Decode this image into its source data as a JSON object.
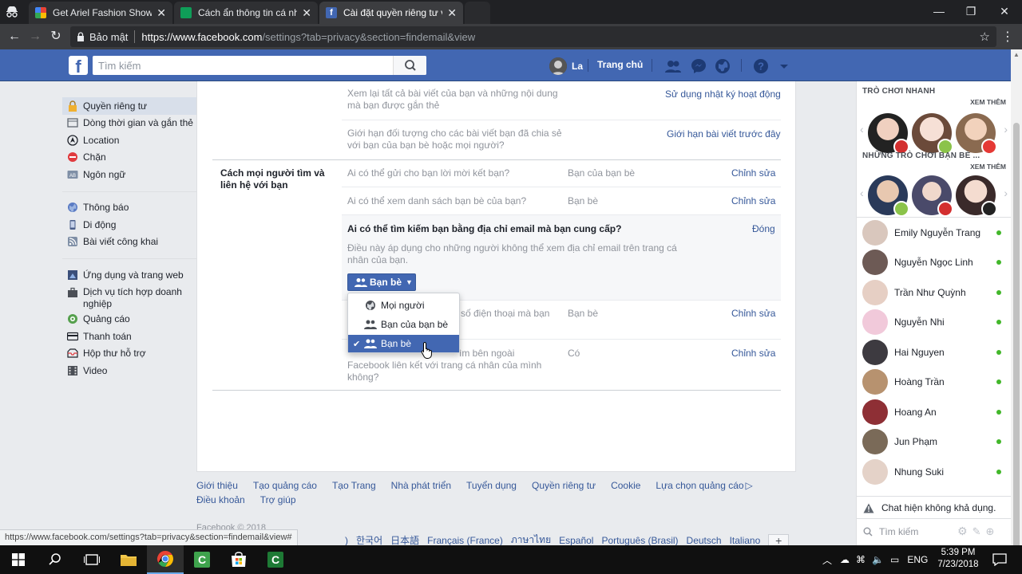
{
  "browser": {
    "tabs": [
      {
        "title": "Get Ariel Fashion Show -",
        "active": false
      },
      {
        "title": "Cách ẩn thông tin cá nhâ",
        "active": false
      },
      {
        "title": "Cài đặt quyền riêng tư và",
        "active": true
      }
    ],
    "security_label": "Bảo mật",
    "url_main": "https://www.facebook.com",
    "url_rest": "/settings?tab=privacy&section=findemail&view",
    "status_url": "https://www.facebook.com/settings?tab=privacy&section=findemail&view#"
  },
  "fb_header": {
    "search_placeholder": "Tìm kiếm",
    "user_name": "La",
    "home_label": "Trang chủ",
    "brand_color": "#4267b2"
  },
  "left_nav": {
    "group1": [
      {
        "label": "Quyền riêng tư",
        "icon": "padlock-icon",
        "active": true
      },
      {
        "label": "Dòng thời gian và gắn thẻ",
        "icon": "timeline-icon"
      },
      {
        "label": "Location",
        "icon": "location-icon"
      },
      {
        "label": "Chặn",
        "icon": "block-icon"
      },
      {
        "label": "Ngôn ngữ",
        "icon": "language-icon"
      }
    ],
    "group2": [
      {
        "label": "Thông báo",
        "icon": "globe-notification-icon"
      },
      {
        "label": "Di động",
        "icon": "mobile-icon"
      },
      {
        "label": "Bài viết công khai",
        "icon": "rss-icon"
      }
    ],
    "group3": [
      {
        "label": "Ứng dụng và trang web",
        "icon": "apps-icon"
      },
      {
        "label": "Dịch vụ tích hợp doanh nghiệp",
        "icon": "business-icon"
      },
      {
        "label": "Quảng cáo",
        "icon": "ads-icon"
      },
      {
        "label": "Thanh toán",
        "icon": "payment-card-icon"
      },
      {
        "label": "Hộp thư hỗ trợ",
        "icon": "support-inbox-icon"
      },
      {
        "label": "Video",
        "icon": "video-icon"
      }
    ]
  },
  "privacy": {
    "top_rows": [
      {
        "question": "Xem lại tất cả bài viết của bạn và những nội dung mà bạn được gắn thẻ",
        "action": "Sử dụng nhật ký hoạt động"
      },
      {
        "question": "Giới hạn đối tượng cho các bài viết bạn đã chia sẻ với bạn của bạn bè hoặc mọi người?",
        "action": "Giới hạn bài viết trước đây"
      }
    ],
    "section_title": "Cách mọi người tìm và liên hệ với bạn",
    "rows": [
      {
        "question": "Ai có thể gửi cho bạn lời mời kết bạn?",
        "value": "Bạn của bạn bè",
        "action": "Chỉnh sửa"
      },
      {
        "question": "Ai có thể xem danh sách bạn bè của bạn?",
        "value": "Bạn bè",
        "action": "Chỉnh sửa"
      }
    ],
    "expanded": {
      "question": "Ai có thể tìm kiếm bạn bằng địa chỉ email mà bạn cung cấp?",
      "close": "Đóng",
      "description": "Điều này áp dụng cho những người không thể xem địa chỉ email trên trang cá nhân của bạn.",
      "selected": "Bạn bè",
      "options": [
        "Mọi người",
        "Bạn của bạn bè",
        "Bạn bè"
      ]
    },
    "phone_row": {
      "question_visible": "số điện thoại mà bạn",
      "value": "Bạn bè",
      "action": "Chỉnh sửa"
    },
    "search_row": {
      "question_part1": "ìm bên ngoài",
      "question_part2": "Facebook liên kết với trang cá nhân của mình",
      "question_part3": "không?",
      "value": "Có",
      "action": "Chỉnh sửa"
    }
  },
  "footer": {
    "links": [
      "Giới thiệu",
      "Tạo quảng cáo",
      "Tạo Trang",
      "Nhà phát triển",
      "Tuyển dụng",
      "Quyền riêng tư",
      "Cookie",
      "Lựa chọn quảng cáo",
      "Điều khoản",
      "Trợ giúp"
    ],
    "copyright": "Facebook © 2018",
    "languages": [
      "한국어",
      "日本語",
      "Français (France)",
      "ภาษาไทย",
      "Español",
      "Português (Brasil)",
      "Deutsch",
      "Italiano"
    ],
    "lang_paren": ")"
  },
  "right_sidebar": {
    "games_header": "TRÒ CHƠI NHANH",
    "see_more": "XEM THÊM",
    "friends_games_header": "NHỮNG TRÒ CHƠI BẠN BÈ ...",
    "see_more_2": "XEM THÊM",
    "contacts": [
      "Emily Nguyễn Trang",
      "Nguyễn Ngọc Linh",
      "Trần Như Quỳnh",
      "Nguyễn Nhi",
      "Hai Nguyen",
      "Hoàng Trần",
      "Hoang An",
      "Jun Phạm",
      "Nhung Suki"
    ],
    "chat_unavailable": "Chat hiện không khả dụng.",
    "chat_search_placeholder": "Tìm kiếm"
  },
  "taskbar": {
    "lang": "ENG",
    "time": "5:39 PM",
    "date": "7/23/2018"
  }
}
